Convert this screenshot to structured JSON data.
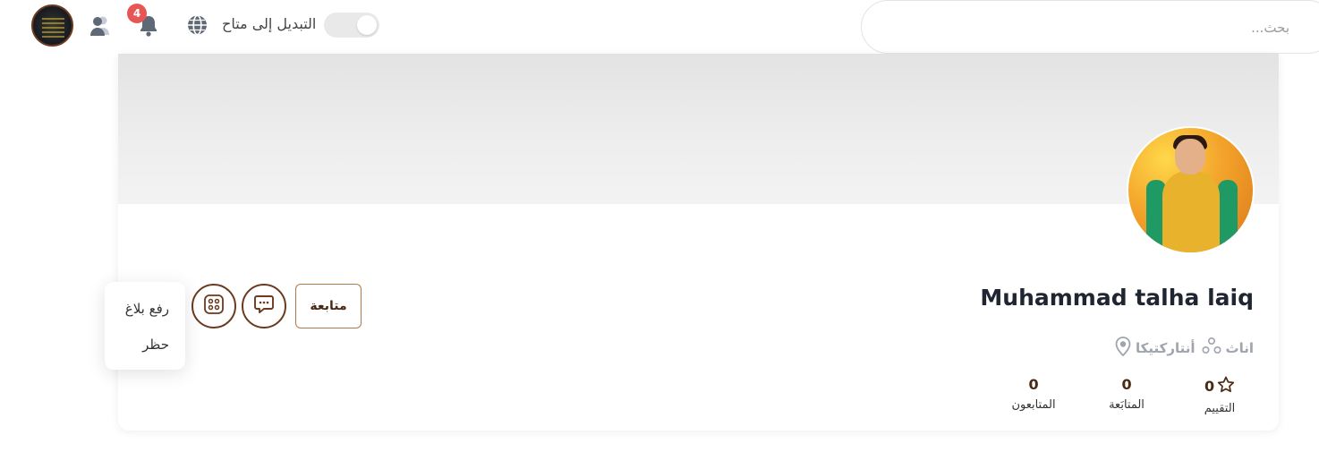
{
  "header": {
    "search_placeholder": "بحث...",
    "toggle_label": "التبديل إلى متاح",
    "notification_count": "4",
    "icons": [
      "user-avatar",
      "users-icon",
      "bell-icon",
      "globe-icon"
    ]
  },
  "profile": {
    "name": "Muhammad talha laiq",
    "location": "أنتاركتيكا",
    "gender": "اناث",
    "follow_label": "متابعة",
    "stats": [
      {
        "value": "0",
        "label": "المتابعون"
      },
      {
        "value": "0",
        "label": "المتابَعة"
      },
      {
        "value": "0",
        "label": "التقييم"
      }
    ]
  },
  "menu": {
    "items": [
      "رفع بلاغ",
      "حظر"
    ]
  },
  "colors": {
    "accent": "#6b3a1f",
    "accent_light": "#b07a4c",
    "badge": "#e85555",
    "muted": "#9fa4ad"
  }
}
